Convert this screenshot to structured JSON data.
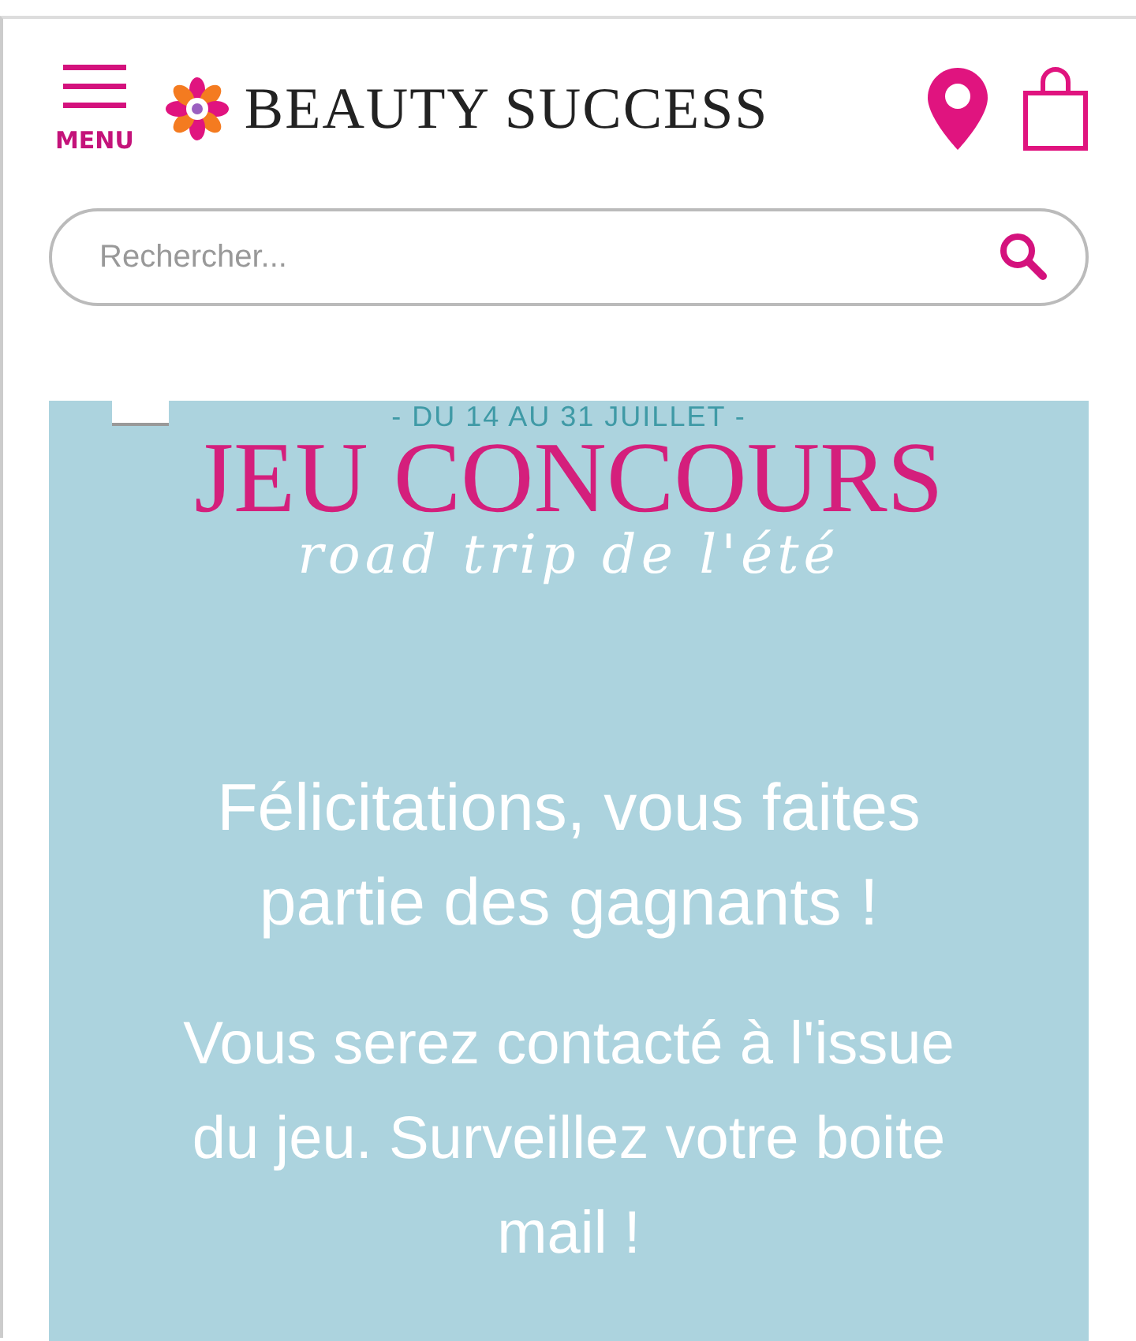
{
  "header": {
    "menu_label": "MENU",
    "brand": "BEAUTY SUCCESS"
  },
  "search": {
    "placeholder": "Rechercher..."
  },
  "banner": {
    "dates": "- DU 14 AU 31 JUILLET -",
    "title": "JEU CONCOURS",
    "subtitle": "road trip de l'été"
  },
  "message": {
    "headline": "Félicitations, vous faites partie des gagnants !",
    "body": "Vous serez contacté à l'issue du jeu. Surveillez votre boite mail !"
  }
}
